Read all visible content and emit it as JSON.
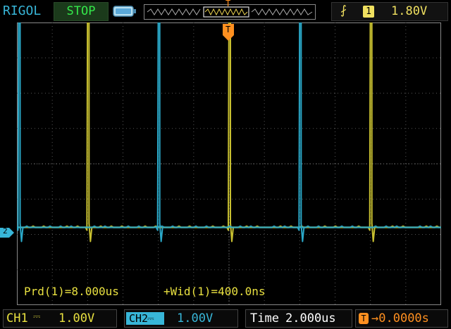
{
  "header": {
    "brand": "RIGOL",
    "run_state": "STOP",
    "trigger_marker": "T",
    "trigger_source": "1",
    "trigger_level": "1.80V"
  },
  "markers": {
    "trigger_position": "T",
    "ch2_ground": "2"
  },
  "measurements": {
    "period": "Prd(1)=8.000us",
    "width": "+Wid(1)=400.0ns"
  },
  "footer": {
    "ch1_label": "CH1",
    "ch1_scale": "1.00V",
    "ch2_label": "CH2",
    "ch2_scale": "1.00V",
    "time_label": "Time",
    "time_value": "2.000us",
    "trigger_offset": "0.0000s"
  },
  "colors": {
    "ch1": "#c8c030",
    "ch2": "#2aa8c8",
    "grid": "#555555",
    "trigger": "#ff9020",
    "accent_cyan": "#38b6d8"
  },
  "chart_data": {
    "type": "line",
    "x_range_us": [
      0,
      24
    ],
    "y_range_div": [
      -4,
      4
    ],
    "series": [
      {
        "channel": "CH1",
        "pulse_times_us": [
          4,
          12,
          20
        ],
        "pulse_amplitude_div": 7.0,
        "baseline_div": -1.8
      },
      {
        "channel": "CH2",
        "pulse_times_us": [
          0.1,
          8,
          16
        ],
        "pulse_amplitude_div": 6.7,
        "baseline_div": -1.8
      }
    ]
  }
}
